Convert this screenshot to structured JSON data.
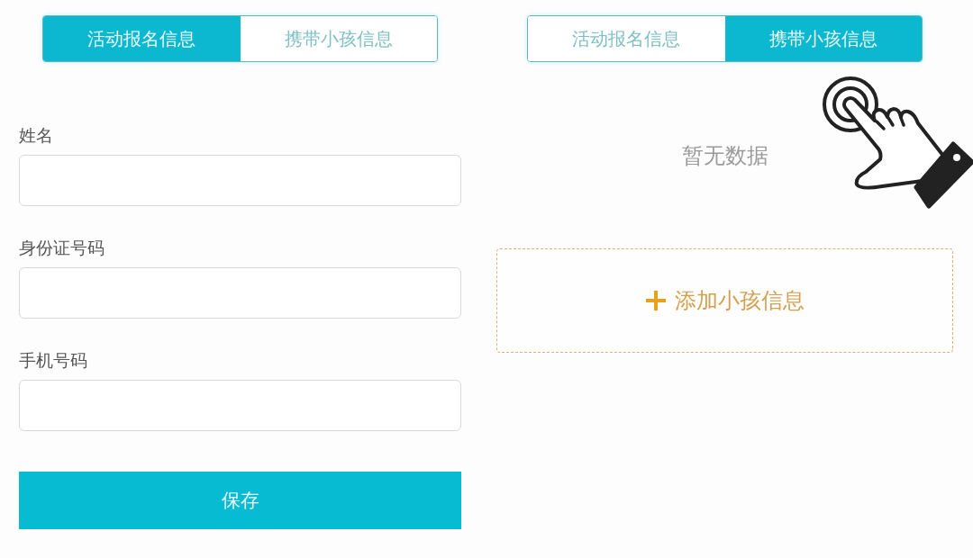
{
  "panels": [
    {
      "kind": "form",
      "tabs": [
        {
          "label": "活动报名信息",
          "selected": true
        },
        {
          "label": "携带小孩信息",
          "selected": false
        }
      ],
      "fields": [
        {
          "label": "姓名"
        },
        {
          "label": "身份证号码"
        },
        {
          "label": "手机号码"
        }
      ],
      "save_button": "保存"
    },
    {
      "kind": "children",
      "tabs": [
        {
          "label": "活动报名信息",
          "selected": false
        },
        {
          "label": "携带小孩信息",
          "selected": true
        }
      ],
      "empty_text": "暂无数据",
      "add_button": "添加小孩信息"
    }
  ]
}
